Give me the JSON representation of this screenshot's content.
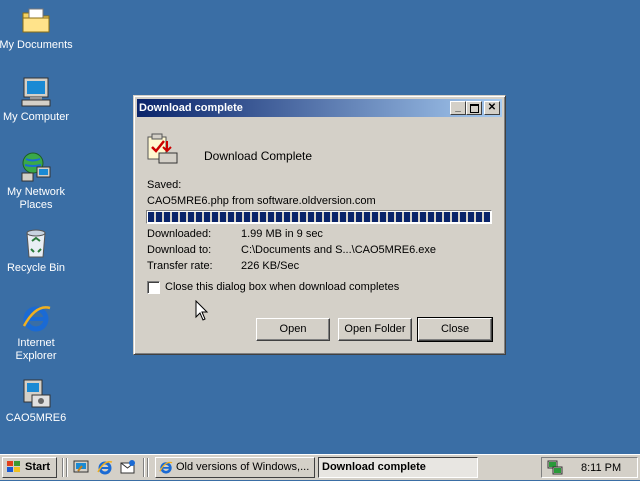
{
  "desktop": {
    "icons": [
      {
        "label": "My Documents",
        "icon": "folder-documents-icon"
      },
      {
        "label": "My Computer",
        "icon": "computer-icon"
      },
      {
        "label": "My Network Places",
        "icon": "network-places-icon"
      },
      {
        "label": "Recycle Bin",
        "icon": "recycle-bin-icon"
      },
      {
        "label": "Internet Explorer",
        "icon": "internet-explorer-icon"
      },
      {
        "label": "CAO5MRE6",
        "icon": "installer-icon"
      }
    ]
  },
  "dialog": {
    "title": "Download complete",
    "heading": "Download Complete",
    "saved_label": "Saved:",
    "saved_value": "CAO5MRE6.php from software.oldversion.com",
    "progress": 1.0,
    "rows": [
      {
        "label": "Downloaded:",
        "value": "1.99 MB in 9 sec"
      },
      {
        "label": "Download to:",
        "value": "C:\\Documents and S...\\CAO5MRE6.exe"
      },
      {
        "label": "Transfer rate:",
        "value": "226 KB/Sec"
      }
    ],
    "checkbox_label": "Close this dialog box when download completes",
    "checkbox_checked": false,
    "buttons": {
      "open": "Open",
      "open_folder": "Open Folder",
      "close": "Close"
    }
  },
  "taskbar": {
    "start_label": "Start",
    "items": [
      {
        "label": "Old versions of Windows,...",
        "active": false
      },
      {
        "label": "Download complete",
        "active": true
      }
    ],
    "clock": "8:11 PM"
  },
  "colors": {
    "desktop": "#3a6ea5",
    "title_active_start": "#0a246a",
    "title_active_end": "#a6caf0",
    "face": "#d4d0c8"
  }
}
